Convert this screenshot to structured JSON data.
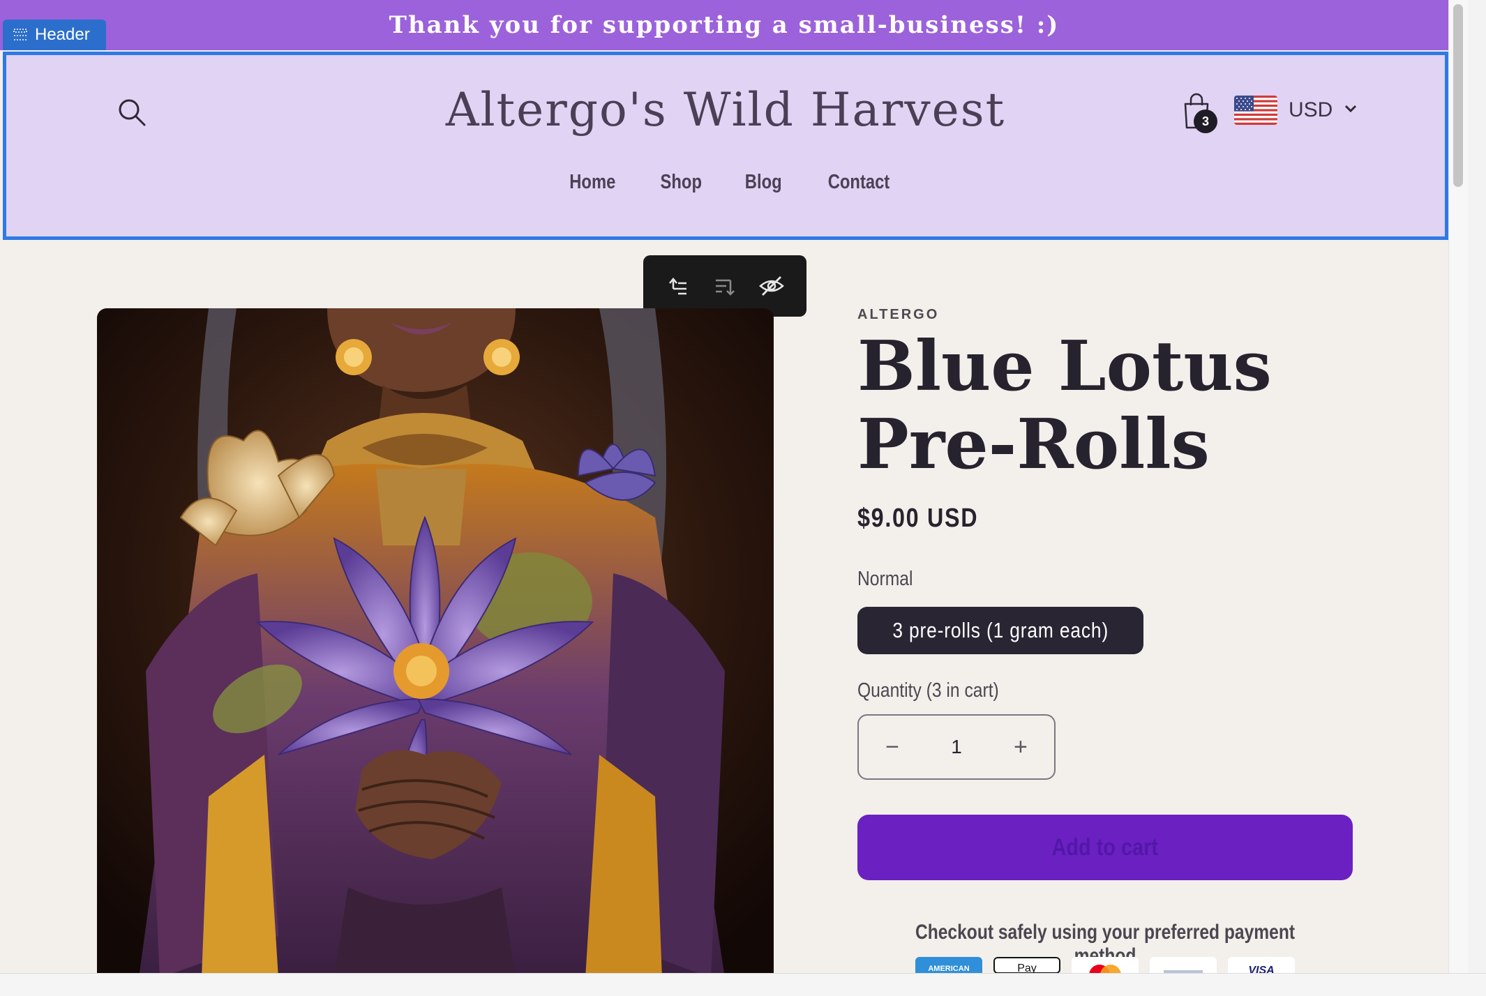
{
  "announcement": {
    "text": "Thank you for supporting a small-business! :)"
  },
  "editor": {
    "section_tag": "Header"
  },
  "header": {
    "site_title": "Altergo's Wild Harvest",
    "nav": [
      "Home",
      "Shop",
      "Blog",
      "Contact"
    ],
    "cart_count": "3",
    "currency": "USD",
    "icons": {
      "search": "search-icon",
      "cart": "shopping-bag-icon",
      "flag": "us-flag-icon",
      "chevron": "chevron-down-icon"
    }
  },
  "block_toolbar": {
    "icons": [
      "select-parent-icon",
      "move-block-icon",
      "hide-block-icon"
    ]
  },
  "product": {
    "vendor": "ALTERGO",
    "title_line1": "Blue Lotus",
    "title_line2": "Pre-Rolls",
    "price": "$9.00 USD",
    "variant_label": "Normal",
    "variant_option": "3 pre-rolls (1 gram each)",
    "quantity_label": "Quantity (3 in cart)",
    "quantity_value": "1",
    "add_to_cart": "Add to cart",
    "checkout_note": "Checkout safely using your preferred payment method",
    "payment_methods": [
      "American Express",
      "Apple Pay",
      "Mastercard",
      "PayPal",
      "Visa"
    ]
  },
  "colors": {
    "announcement_bg": "#9c62dc",
    "header_bg": "#e0d3f3",
    "selection_outline": "#2f7ae5",
    "page_bg": "#f3efeb",
    "add_to_cart_bg": "#6b20c2",
    "variant_pill_bg": "#292533"
  }
}
